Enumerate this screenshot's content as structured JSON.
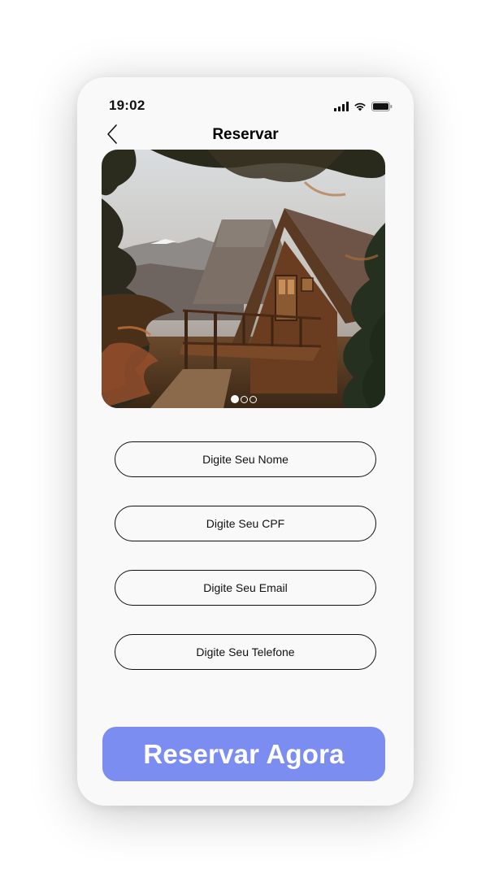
{
  "status_bar": {
    "time": "19:02",
    "icons": [
      "signal-icon",
      "wifi-icon",
      "battery-icon"
    ]
  },
  "nav": {
    "back_icon": "chevron-left-icon",
    "title": "Reservar"
  },
  "hero": {
    "image": "cabin-in-forest-photo",
    "carousel": {
      "total": 3,
      "active": 1
    }
  },
  "form": {
    "name_placeholder": "Digite Seu Nome",
    "cpf_placeholder": "Digite Seu CPF",
    "email_placeholder": "Digite Seu Email",
    "phone_placeholder": "Digite Seu Telefone"
  },
  "cta": {
    "label": "Reservar Agora"
  },
  "colors": {
    "accent": "#7b8df0",
    "background": "#f9f9f9",
    "text": "#111111"
  }
}
